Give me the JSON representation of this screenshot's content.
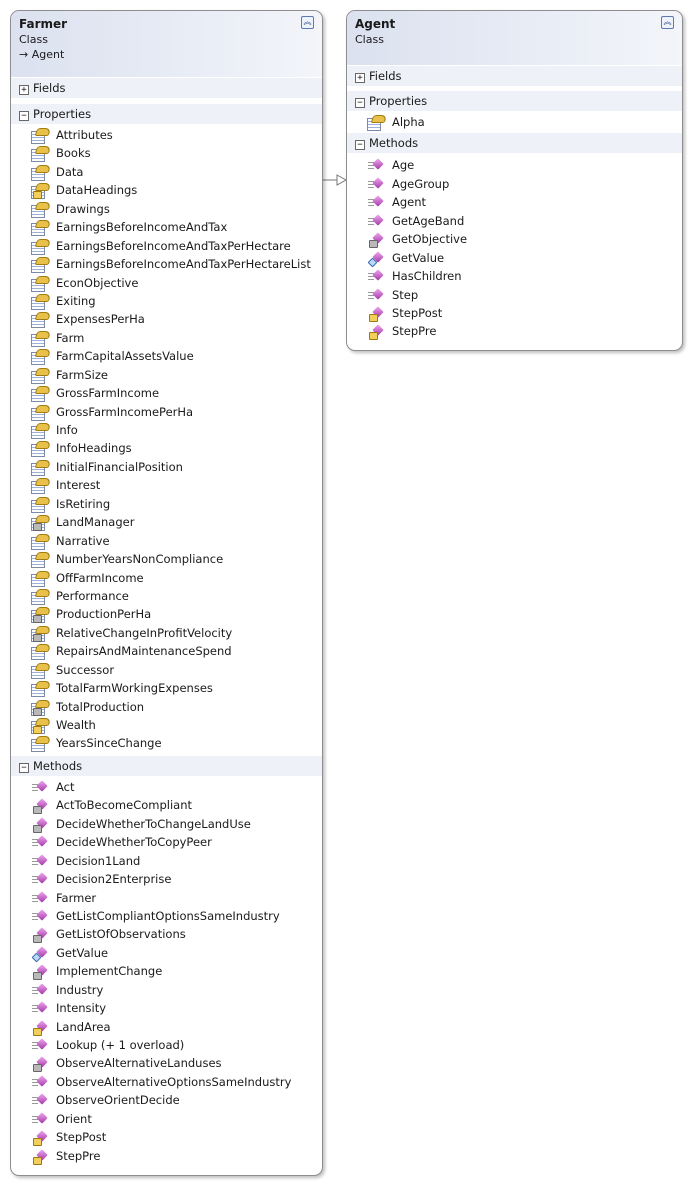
{
  "farmer": {
    "name": "Farmer",
    "kind": "Class",
    "base": "→ Agent",
    "sections": {
      "fields": "Fields",
      "properties": "Properties",
      "methods": "Methods"
    },
    "properties": [
      {
        "name": "Attributes",
        "access": "public"
      },
      {
        "name": "Books",
        "access": "public"
      },
      {
        "name": "Data",
        "access": "public"
      },
      {
        "name": "DataHeadings",
        "access": "protected"
      },
      {
        "name": "Drawings",
        "access": "public"
      },
      {
        "name": "EarningsBeforeIncomeAndTax",
        "access": "public"
      },
      {
        "name": "EarningsBeforeIncomeAndTaxPerHectare",
        "access": "public"
      },
      {
        "name": "EarningsBeforeIncomeAndTaxPerHectareList",
        "access": "public"
      },
      {
        "name": "EconObjective",
        "access": "public"
      },
      {
        "name": "Exiting",
        "access": "public"
      },
      {
        "name": "ExpensesPerHa",
        "access": "public"
      },
      {
        "name": "Farm",
        "access": "public"
      },
      {
        "name": "FarmCapitalAssetsValue",
        "access": "public"
      },
      {
        "name": "FarmSize",
        "access": "public"
      },
      {
        "name": "GrossFarmIncome",
        "access": "public"
      },
      {
        "name": "GrossFarmIncomePerHa",
        "access": "public"
      },
      {
        "name": "Info",
        "access": "public"
      },
      {
        "name": "InfoHeadings",
        "access": "public"
      },
      {
        "name": "InitialFinancialPosition",
        "access": "public"
      },
      {
        "name": "Interest",
        "access": "public"
      },
      {
        "name": "IsRetiring",
        "access": "public"
      },
      {
        "name": "LandManager",
        "access": "private"
      },
      {
        "name": "Narrative",
        "access": "public"
      },
      {
        "name": "NumberYearsNonCompliance",
        "access": "public"
      },
      {
        "name": "OffFarmIncome",
        "access": "public"
      },
      {
        "name": "Performance",
        "access": "public"
      },
      {
        "name": "ProductionPerHa",
        "access": "private"
      },
      {
        "name": "RelativeChangeInProfitVelocity",
        "access": "private"
      },
      {
        "name": "RepairsAndMaintenanceSpend",
        "access": "public"
      },
      {
        "name": "Successor",
        "access": "public"
      },
      {
        "name": "TotalFarmWorkingExpenses",
        "access": "public"
      },
      {
        "name": "TotalProduction",
        "access": "private"
      },
      {
        "name": "Wealth",
        "access": "protected"
      },
      {
        "name": "YearsSinceChange",
        "access": "public"
      }
    ],
    "methods": [
      {
        "name": "Act",
        "access": "public"
      },
      {
        "name": "ActToBecomeCompliant",
        "access": "private"
      },
      {
        "name": "DecideWhetherToChangeLandUse",
        "access": "private"
      },
      {
        "name": "DecideWhetherToCopyPeer",
        "access": "public"
      },
      {
        "name": "Decision1Land",
        "access": "public"
      },
      {
        "name": "Decision2Enterprise",
        "access": "public"
      },
      {
        "name": "Farmer",
        "access": "public"
      },
      {
        "name": "GetListCompliantOptionsSameIndustry",
        "access": "public"
      },
      {
        "name": "GetListOfObservations",
        "access": "private"
      },
      {
        "name": "GetValue",
        "access": "override"
      },
      {
        "name": "ImplementChange",
        "access": "private"
      },
      {
        "name": "Industry",
        "access": "public"
      },
      {
        "name": "Intensity",
        "access": "public"
      },
      {
        "name": "LandArea",
        "access": "protected"
      },
      {
        "name": "Lookup (+ 1 overload)",
        "access": "public"
      },
      {
        "name": "ObserveAlternativeLanduses",
        "access": "private"
      },
      {
        "name": "ObserveAlternativeOptionsSameIndustry",
        "access": "public"
      },
      {
        "name": "ObserveOrientDecide",
        "access": "public"
      },
      {
        "name": "Orient",
        "access": "public"
      },
      {
        "name": "StepPost",
        "access": "protected"
      },
      {
        "name": "StepPre",
        "access": "protected"
      }
    ]
  },
  "agent": {
    "name": "Agent",
    "kind": "Class",
    "sections": {
      "fields": "Fields",
      "properties": "Properties",
      "methods": "Methods"
    },
    "properties": [
      {
        "name": "Alpha",
        "access": "public"
      }
    ],
    "methods": [
      {
        "name": "Age",
        "access": "public"
      },
      {
        "name": "AgeGroup",
        "access": "public"
      },
      {
        "name": "Agent",
        "access": "public"
      },
      {
        "name": "GetAgeBand",
        "access": "public"
      },
      {
        "name": "GetObjective",
        "access": "private"
      },
      {
        "name": "GetValue",
        "access": "override"
      },
      {
        "name": "HasChildren",
        "access": "public"
      },
      {
        "name": "Step",
        "access": "public"
      },
      {
        "name": "StepPost",
        "access": "protected"
      },
      {
        "name": "StepPre",
        "access": "protected"
      }
    ]
  },
  "icons": {
    "collapse": "chevron-double-up-icon",
    "expanded": "minus-box-icon",
    "collapsed": "plus-box-icon",
    "property": "property-icon",
    "method": "method-icon"
  }
}
